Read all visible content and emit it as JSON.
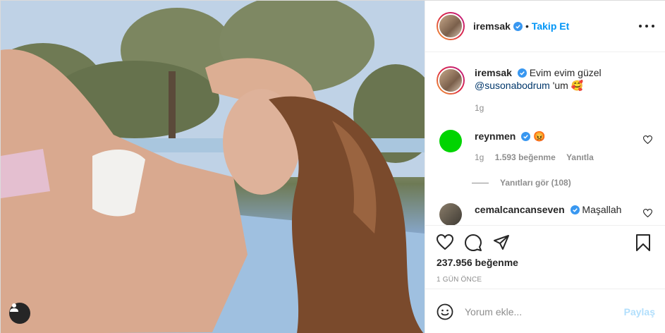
{
  "post": {
    "username": "iremsak",
    "follow_label": "Takip Et",
    "dot": "•",
    "caption": {
      "text_1": "Evim evim güzel",
      "mention": "@susonabodrum",
      "text_2": "'um",
      "emoji": "🥰",
      "time": "1g"
    },
    "likes": "237.956 beğenme",
    "time_ago": "1 GÜN ÖNCE"
  },
  "comments": [
    {
      "username": "reynmen",
      "text": "😡",
      "time": "1g",
      "likes": "1.593 beğenme",
      "reply_label": "Yanıtla",
      "view_replies": "Yanıtları gör (108)"
    },
    {
      "username": "cemalcancanseven",
      "text": "Maşallah"
    }
  ],
  "add_comment": {
    "placeholder": "Yorum ekle...",
    "post_label": "Paylaş"
  },
  "icons": {
    "like": "heart-icon",
    "comment": "comment-icon",
    "share": "share-icon",
    "save": "bookmark-icon",
    "emoji": "smiley-icon",
    "more": "more-icon",
    "user_tag": "user-tag-icon",
    "verified": "verified-badge-icon"
  },
  "colors": {
    "link_blue": "#0095f6",
    "mention_blue": "#00376b",
    "muted": "#8e8e8e",
    "verified": "#3897f0"
  }
}
